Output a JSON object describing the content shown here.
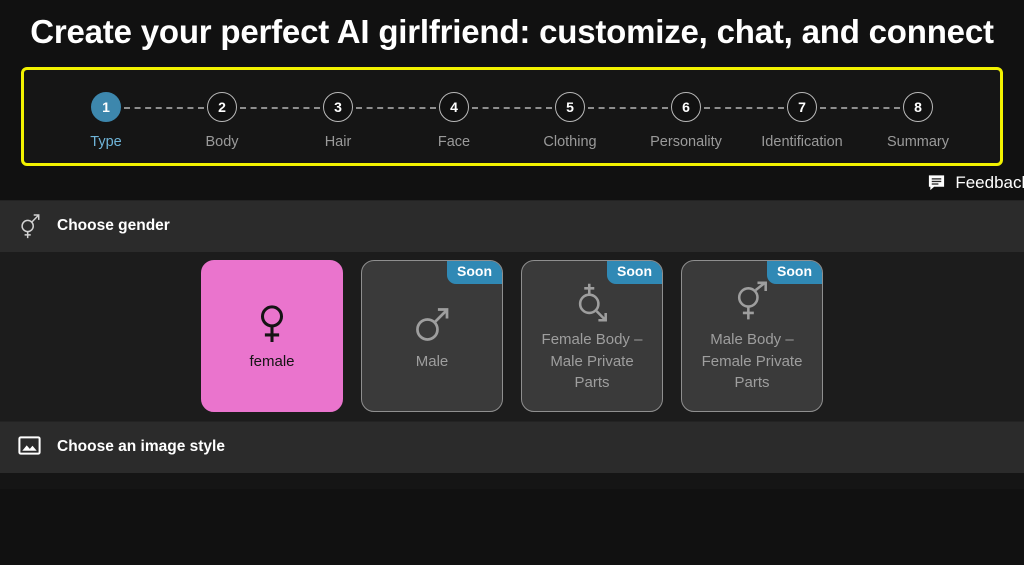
{
  "header": {
    "title": "Create your perfect AI girlfriend: customize, chat, and connect"
  },
  "stepper": {
    "highlight_color": "#f2f200",
    "active_color": "#3d87ad",
    "active_index": 1,
    "steps": [
      {
        "number": "1",
        "label": "Type"
      },
      {
        "number": "2",
        "label": "Body"
      },
      {
        "number": "3",
        "label": "Hair"
      },
      {
        "number": "4",
        "label": "Face"
      },
      {
        "number": "5",
        "label": "Clothing"
      },
      {
        "number": "6",
        "label": "Personality"
      },
      {
        "number": "7",
        "label": "Identification"
      },
      {
        "number": "8",
        "label": "Summary"
      }
    ]
  },
  "feedback": {
    "label": "Feedback",
    "icon": "chat-bubble-icon"
  },
  "gender_section": {
    "title": "Choose gender",
    "icon": "intersex-symbol-icon",
    "cards": [
      {
        "label": "female",
        "icon": "venus-symbol-icon",
        "selected": true,
        "badge": null,
        "color": "#ea74cd"
      },
      {
        "label": "Male",
        "icon": "mars-symbol-icon",
        "selected": false,
        "badge": "Soon"
      },
      {
        "label": "Female Body – Male Private Parts",
        "icon": "transgender-female-body-icon",
        "selected": false,
        "badge": "Soon"
      },
      {
        "label": "Male Body – Female Private Parts",
        "icon": "transgender-male-body-icon",
        "selected": false,
        "badge": "Soon"
      }
    ]
  },
  "image_style_section": {
    "title": "Choose an image style",
    "icon": "image-picture-icon"
  }
}
